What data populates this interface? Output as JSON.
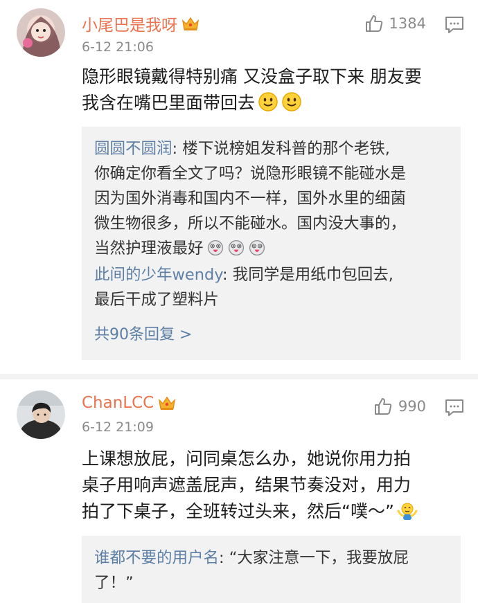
{
  "comments": [
    {
      "username": "小尾巴是我呀",
      "time": "6-12 21:06",
      "likes": "1384",
      "content_line1": "隐形眼镜戴得特别痛 又没盒子取下来 朋友要",
      "content_line2": "我含在嘴巴里面带回去",
      "replies": [
        {
          "name": "圆圆不圆润",
          "text_line1": ": 楼下说榜姐发科普的那个老铁,",
          "text_line2": "你确定你看全文了吗？说隐形眼镜不能碰水是",
          "text_line3": "因为国外消毒和国内不一样，国外水里的细菌",
          "text_line4": "微生物很多，所以不能碰水。国内没大事的，",
          "text_line5": "当然护理液最好"
        },
        {
          "name": "此间的少年wendy",
          "text_line1": ": 我同学是用纸巾包回去,",
          "text_line2": "最后干成了塑料片"
        }
      ],
      "more": "共90条回复 >"
    },
    {
      "username": "ChanLCC",
      "time": "6-12 21:09",
      "likes": "990",
      "content_line1": "上课想放屁，问同桌怎么办，她说你用力拍",
      "content_line2": "桌子用响声遮盖屁声，结果节奏没对，用力",
      "content_line3": "拍了下桌子，全班转过头来，然后“噗～”",
      "replies": [
        {
          "name": "谁都不要的用户名",
          "text_line1": ": “大家注意一下，我要放屁",
          "text_line2": "了！”"
        }
      ]
    }
  ]
}
